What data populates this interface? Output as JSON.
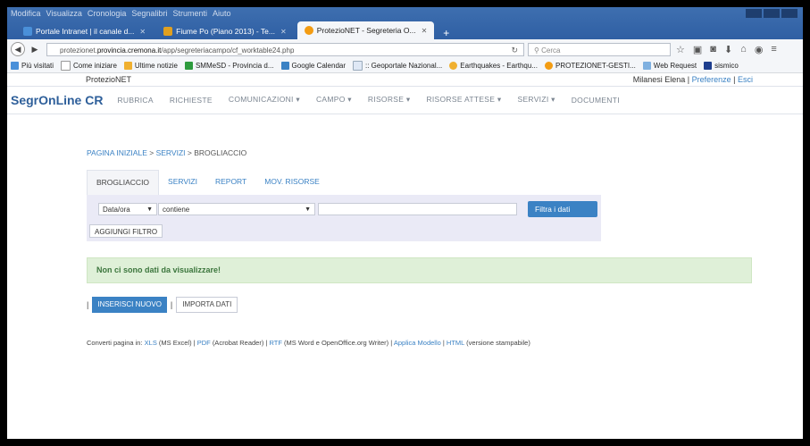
{
  "browser": {
    "menu": [
      "Modifica",
      "Visualizza",
      "Cronologia",
      "Segnalibri",
      "Strumenti",
      "Aiuto"
    ],
    "tabs": [
      {
        "label": "Portale Intranet | il canale d...",
        "color": "#4a90d9"
      },
      {
        "label": "Fiume Po (Piano 2013) - Te...",
        "color": "#e0a020"
      },
      {
        "label": "ProtezioNET - Segreteria O...",
        "color": "#f39c12"
      }
    ],
    "newtab": "+",
    "url_prefix": "protezionet.",
    "url_domain": "provincia.cremona.it",
    "url_path": "/app/segreteriacampo/cf_worktable24.php",
    "search_placeholder": "Cerca",
    "bookmarks": [
      {
        "label": "Più visitati",
        "color": "#4a90d9"
      },
      {
        "label": "Come iniziare",
        "color": "#ffffff"
      },
      {
        "label": "Ultime notizie",
        "color": "#f0b030"
      },
      {
        "label": "SMMeSD - Provincia d...",
        "color": "#2e9b3e"
      },
      {
        "label": "Google Calendar",
        "color": "#3b82c4"
      },
      {
        "label": ":: Geoportale Nazional...",
        "color": "#dfe8f5"
      },
      {
        "label": "Earthquakes - Earthqu...",
        "color": "#f0b030"
      },
      {
        "label": "PROTEZIONET-GESTI...",
        "color": "#f39c12"
      },
      {
        "label": "Web Request",
        "color": "#7fb0e0"
      },
      {
        "label": "sismico",
        "color": "#1e3e8e"
      }
    ]
  },
  "app": {
    "name": "ProtezioNET",
    "user": "Milanesi Elena",
    "preferences": "Preferenze",
    "logout": "Esci",
    "brand": "SegrOnLine CR",
    "nav": [
      "RUBRICA",
      "RICHIESTE",
      "COMUNICAZIONI ▾",
      "CAMPO ▾",
      "RISORSE ▾",
      "RISORSE ATTESE ▾",
      "SERVIZI ▾",
      "DOCUMENTI"
    ]
  },
  "breadcrumb": {
    "home": "PAGINA INIZIALE",
    "section": "SERVIZI",
    "current": "BROGLIACCIO",
    "sep": ">"
  },
  "subtabs": [
    "BROGLIACCIO",
    "SERVIZI",
    "REPORT",
    "MOV. RISORSE"
  ],
  "filter": {
    "field": "Data/ora",
    "operator": "contiene",
    "value": "",
    "apply": "Filtra i dati",
    "add": "AGGIUNGI FILTRO"
  },
  "alert": "Non ci sono dati da visualizzare!",
  "actions": {
    "insert": "INSERISCI NUOVO",
    "import": "IMPORTA DATI"
  },
  "convert": {
    "prefix": "Converti pagina in:",
    "xls": "XLS",
    "xls_note": "(MS Excel)",
    "pdf": "PDF",
    "pdf_note": "(Acrobat Reader)",
    "rtf": "RTF",
    "rtf_note": "(MS Word e OpenOffice.org Writer)",
    "model": "Applica Modello",
    "html": "HTML",
    "html_note": "(versione stampabile)"
  },
  "colors": {
    "accent": "#3b82c4",
    "brand": "#2e5f9a",
    "success_bg": "#dff0d8",
    "filter_bg": "#eaeaf6"
  }
}
